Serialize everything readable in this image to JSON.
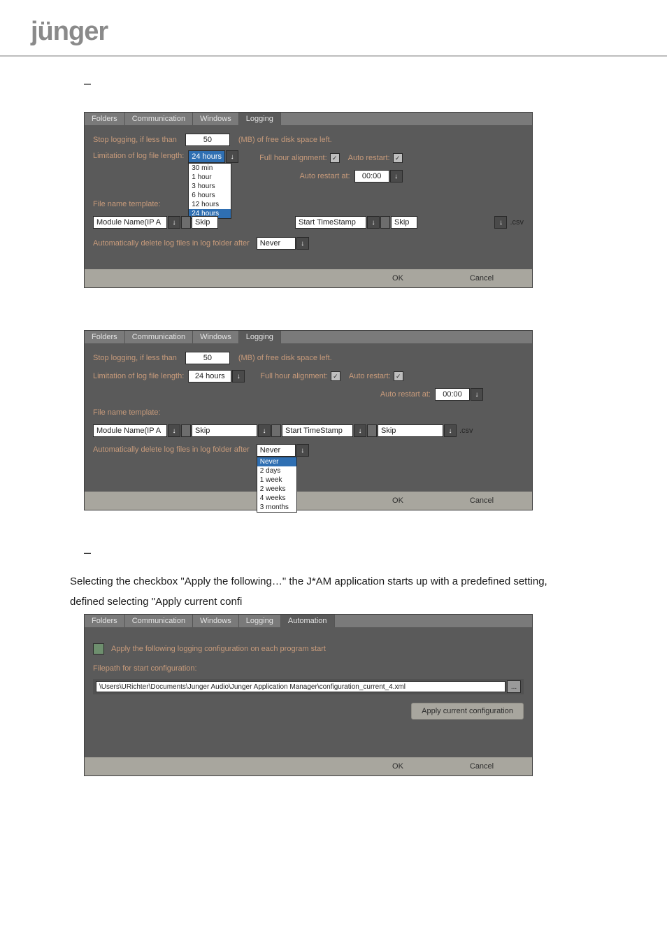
{
  "logo_text": "jünger",
  "dash": "–",
  "panel1": {
    "tabs": [
      "Folders",
      "Communication",
      "Windows",
      "Logging"
    ],
    "active_tab": "Logging",
    "stop_logging_label": "Stop logging, if less than",
    "stop_logging_value": "50",
    "stop_logging_unit": "(MB) of free disk space left.",
    "limitation_label": "Limitation of log file length:",
    "limitation_value": "24 hours",
    "limitation_options": [
      "30 min",
      "1 hour",
      "3 hours",
      "6 hours",
      "12 hours",
      "24 hours"
    ],
    "full_hour_label": "Full hour alignment:",
    "auto_restart_label": "Auto restart:",
    "auto_restart_at_label": "Auto restart at:",
    "auto_restart_at_value": "00:00",
    "file_name_template_label": "File name template:",
    "template_seg1": "Module Name(IP A",
    "template_sep1": "Skip",
    "template_seg2": "Start TimeStamp",
    "template_sep2": "Skip",
    "template_ext": ".csv",
    "auto_delete_label": "Automatically delete log files in log folder after",
    "auto_delete_value": "Never",
    "ok": "OK",
    "cancel": "Cancel"
  },
  "panel2": {
    "tabs": [
      "Folders",
      "Communication",
      "Windows",
      "Logging"
    ],
    "active_tab": "Logging",
    "stop_logging_label": "Stop logging, if less than",
    "stop_logging_value": "50",
    "stop_logging_unit": "(MB) of free disk space left.",
    "limitation_label": "Limitation of log file length:",
    "limitation_value": "24 hours",
    "full_hour_label": "Full hour alignment:",
    "auto_restart_label": "Auto restart:",
    "auto_restart_at_label": "Auto restart at:",
    "auto_restart_at_value": "00:00",
    "file_name_template_label": "File name template:",
    "template_seg1": "Module Name(IP A",
    "template_sep1": "Skip",
    "template_seg2": "Start TimeStamp",
    "template_sep2": "Skip",
    "template_ext": ".csv",
    "auto_delete_label": "Automatically delete log files in log folder after",
    "auto_delete_value": "Never",
    "auto_delete_options": [
      "Never",
      "2 days",
      "1 week",
      "2 weeks",
      "4 weeks",
      "3 months"
    ],
    "ok": "OK",
    "cancel": "Cancel"
  },
  "body_text_1": "Selecting the checkbox \"Apply the following…\" the J*AM  application starts up with a predefined setting,",
  "body_text_2": "defined selecting \"Apply current confi",
  "panel3": {
    "tabs": [
      "Folders",
      "Communication",
      "Windows",
      "Logging",
      "Automation"
    ],
    "active_tab": "Automation",
    "apply_label": "Apply the following logging configuration on each program start",
    "filepath_label": "Filepath for start configuration:",
    "filepath_value": "\\Users\\URichter\\Documents\\Junger Audio\\Junger Application Manager\\configuration_current_4.xml",
    "more_btn": "...",
    "apply_current_btn": "Apply current configuration",
    "ok": "OK",
    "cancel": "Cancel"
  }
}
